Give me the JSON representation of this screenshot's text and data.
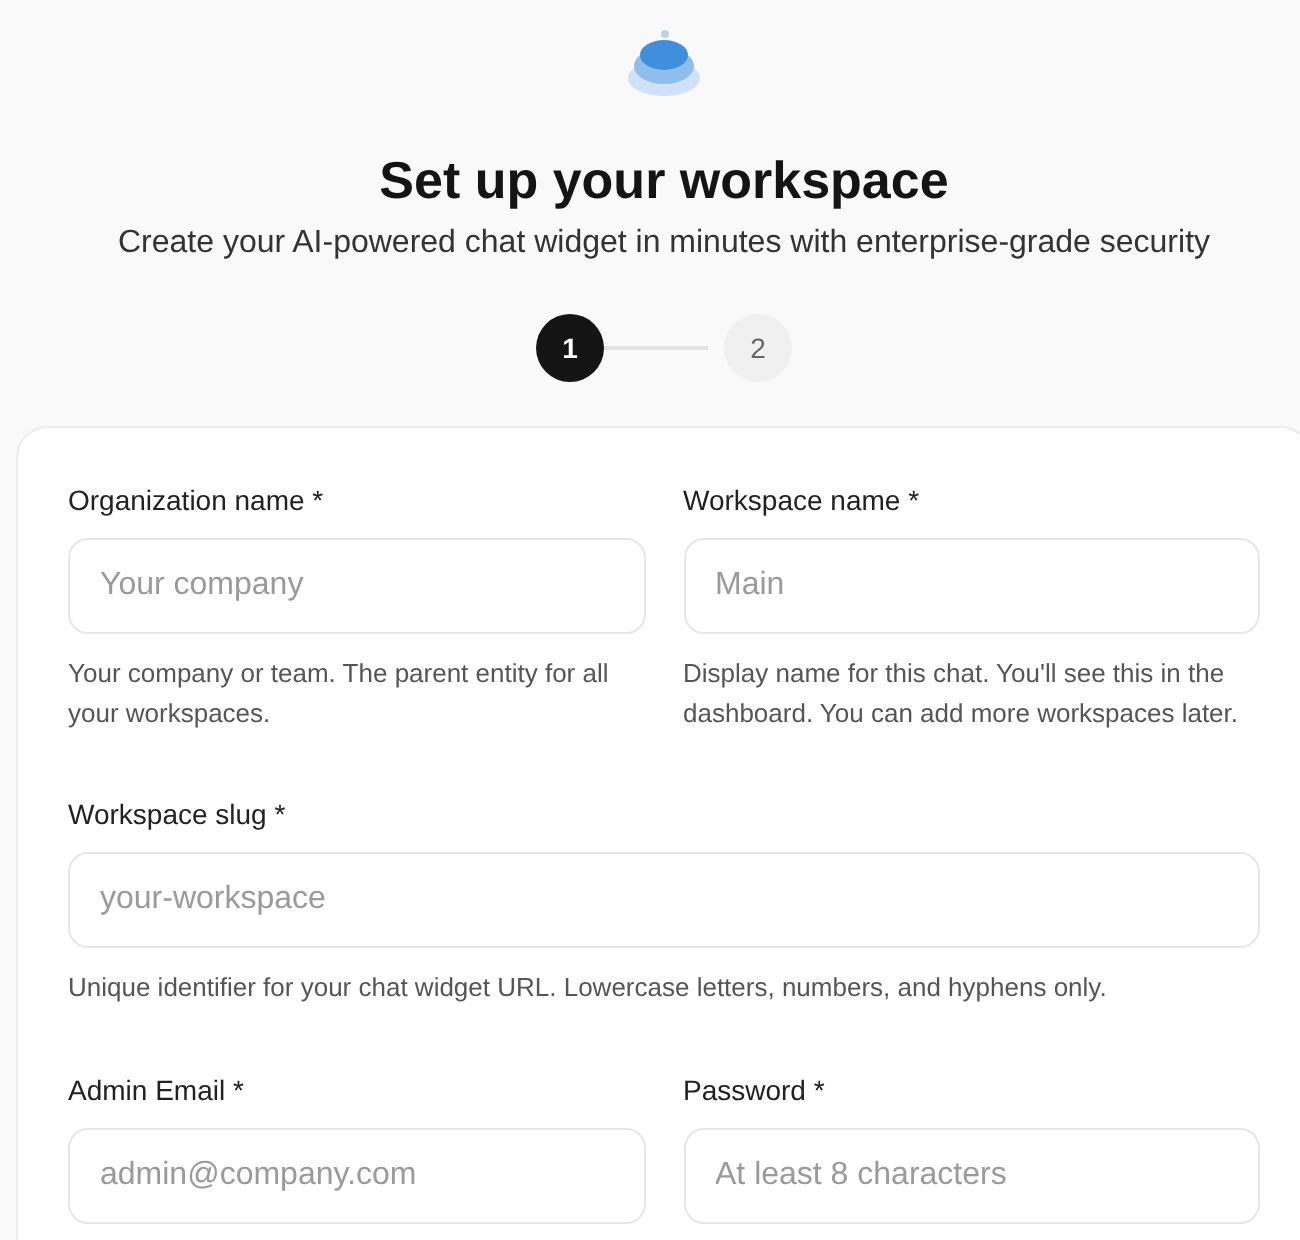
{
  "header": {
    "title": "Set up your workspace",
    "subtitle": "Create your AI-powered chat widget in minutes with enterprise-grade security"
  },
  "steps": [
    {
      "label": "1",
      "selected": true
    },
    {
      "label": "2",
      "selected": false
    }
  ],
  "form": {
    "rows": [
      {
        "fields": [
          {
            "label": "Organization name *",
            "placeholder": "Your company",
            "help": "Your company or team. The parent entity for all your workspaces."
          },
          {
            "label": "Workspace name *",
            "placeholder": "Main",
            "help": "Display name for this chat. You'll see this in the dashboard. You can add more workspaces later."
          }
        ]
      },
      {
        "fields": [
          {
            "label": "Workspace slug *",
            "placeholder": "your-workspace",
            "help": "Unique identifier for your chat widget URL. Lowercase letters, numbers, and hyphens only."
          }
        ]
      },
      {
        "fields": [
          {
            "label": "Admin Email *",
            "placeholder": "admin@company.com"
          },
          {
            "label": "Password *",
            "placeholder": "At least 8 characters"
          }
        ]
      }
    ]
  }
}
